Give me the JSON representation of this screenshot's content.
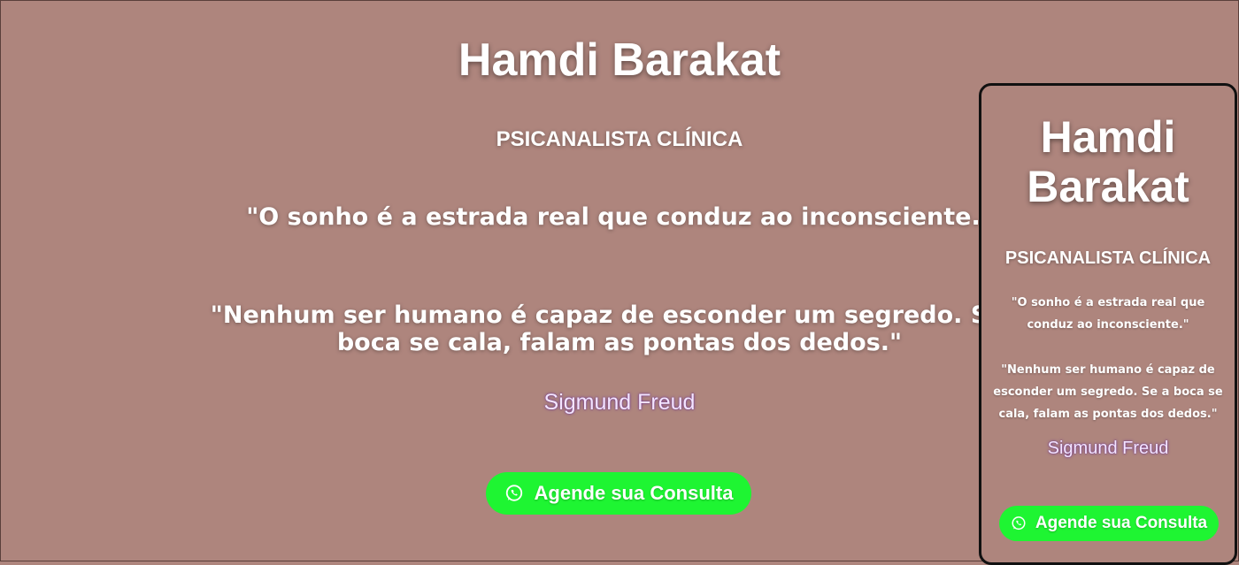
{
  "desktop": {
    "title": "Hamdi Barakat",
    "subtitle": "PSICANALISTA CLÍNICA",
    "quote1": "\"O sonho é a estrada real que conduz ao inconsciente.\"",
    "quote2": "\"Nenhum ser humano é capaz de esconder um segredo. Se a boca se cala, falam as pontas dos dedos.\"",
    "author": "Sigmund Freud",
    "cta_label": "Agende sua Consulta"
  },
  "mobile": {
    "title": "Hamdi Barakat",
    "subtitle": "PSICANALISTA CLÍNICA",
    "quote1": "\"O sonho é a estrada real que conduz ao inconsciente.\"",
    "quote2": "\"Nenhum ser humano é capaz de esconder um segredo. Se a boca se cala, falam as pontas dos dedos.\"",
    "author": "Sigmund Freud",
    "cta_label": "Agende sua Consulta"
  },
  "icons": {
    "cta_icon": "whatsapp-icon"
  },
  "colors": {
    "background": "#ae857d",
    "cta_green": "#1ef532",
    "author_text": "#f4e6ff",
    "phone_border": "#111111"
  }
}
